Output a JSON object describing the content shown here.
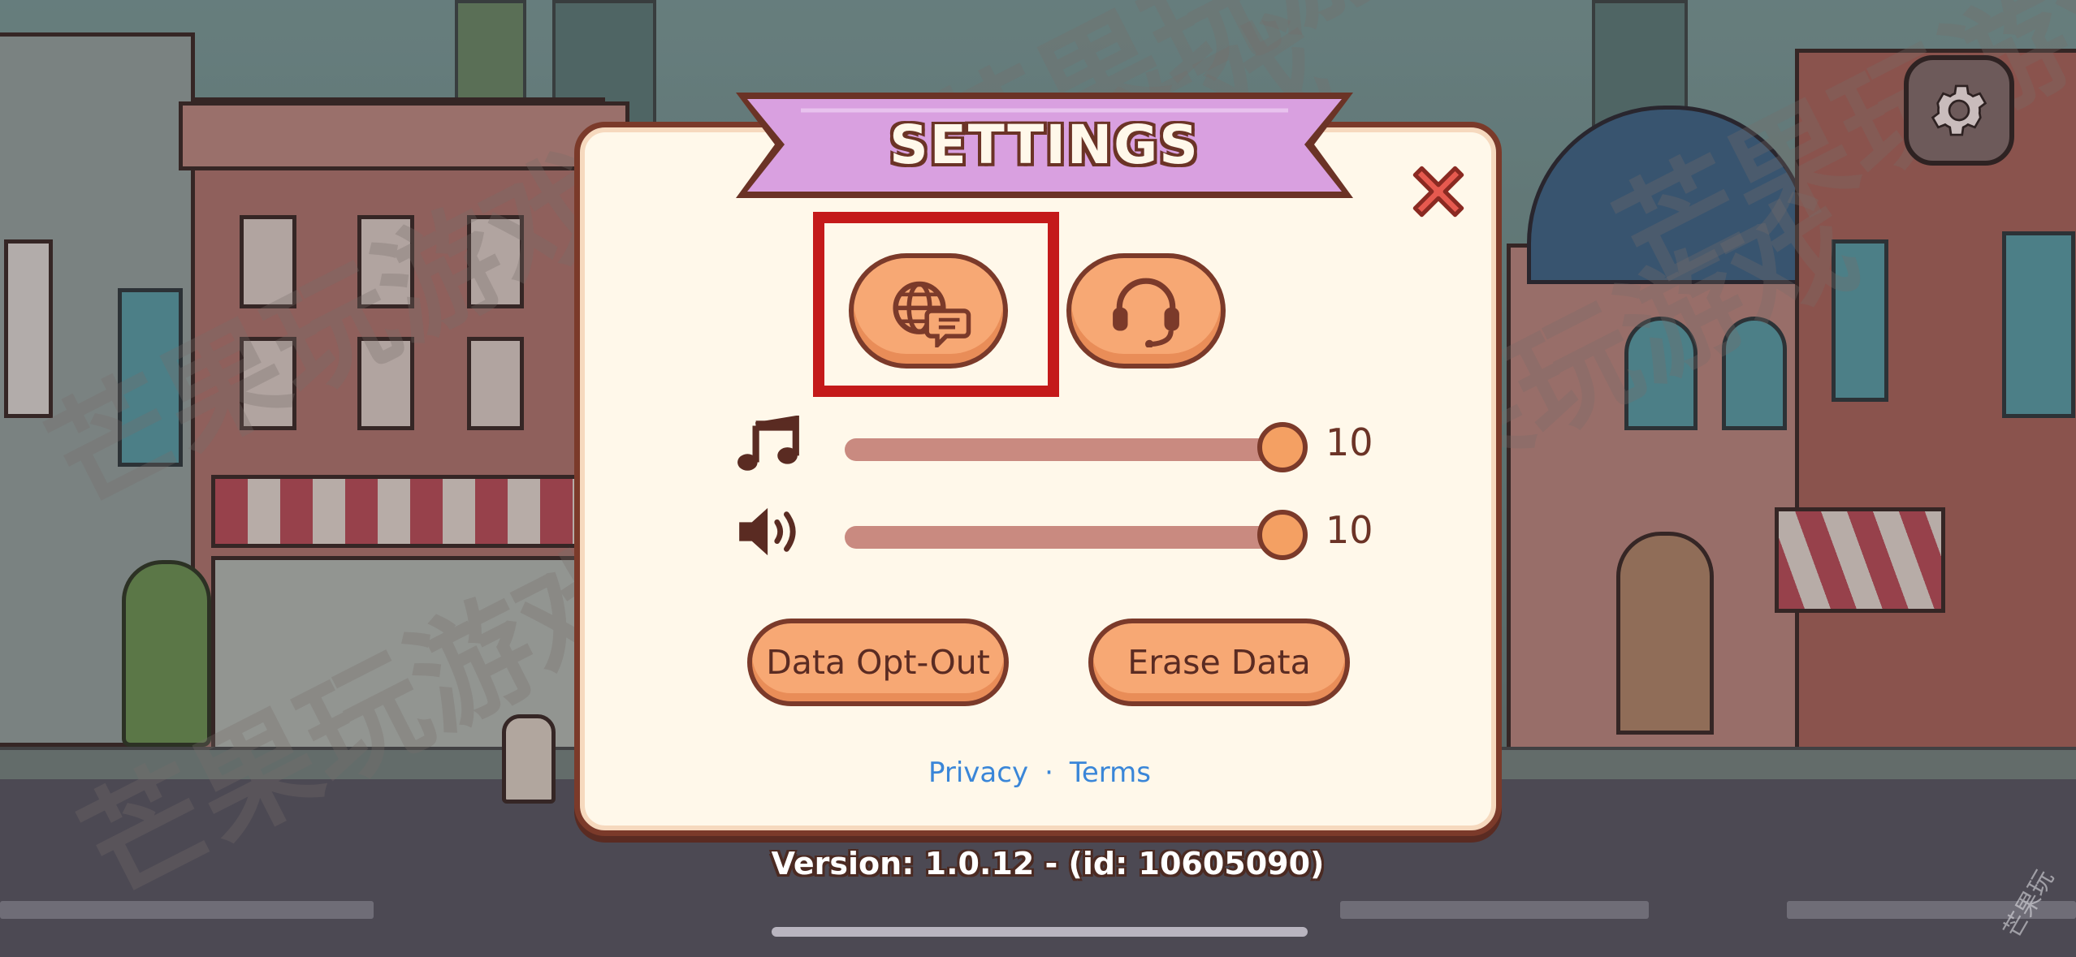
{
  "screen": "settings",
  "panel": {
    "title": "SETTINGS",
    "close_icon": "close-x-icon",
    "language_button_icon": "globe-chat-icon",
    "support_button_icon": "headset-icon",
    "music": {
      "icon": "music-note-icon",
      "level": 10,
      "value_text": "10"
    },
    "sound": {
      "icon": "speaker-icon",
      "level": 10,
      "value_text": "10"
    },
    "data_opt_out_label": "Data Opt-Out",
    "erase_data_label": "Erase Data",
    "privacy_label": "Privacy",
    "separator": "·",
    "terms_label": "Terms"
  },
  "version_text": "Version: 1.0.12  - (id: 10605090)",
  "gear_icon": "gear-icon",
  "watermark_text": "芒果玩游戏",
  "corner_mark": "芒果玩",
  "colors": {
    "panel_bg": "#fff8ea",
    "panel_border": "#7b3a2a",
    "ribbon": "#d9a0e0",
    "button": "#f7a874",
    "slider_track": "#c98a80",
    "knob": "#f4a063",
    "link": "#3a86d8",
    "highlight": "#c41a1a",
    "close": "#e65a4f"
  }
}
